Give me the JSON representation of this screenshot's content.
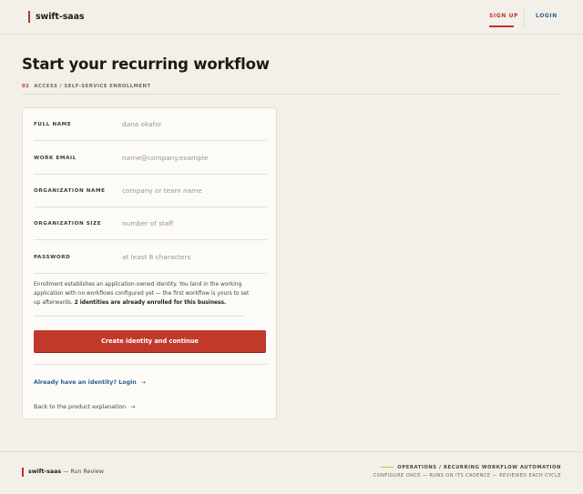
{
  "header": {
    "brand": "swift-saas",
    "nav": {
      "signup": "SIGN UP",
      "login": "LOGIN"
    }
  },
  "page": {
    "title": "Start your recurring workflow",
    "breadcrumb": {
      "step": "02",
      "text": "ACCESS / SELF-SERVICE ENROLLMENT"
    }
  },
  "form": {
    "fields": [
      {
        "label": "FULL NAME",
        "placeholder": "dana okafor"
      },
      {
        "label": "WORK EMAIL",
        "placeholder": "name@company.example"
      },
      {
        "label": "ORGANIZATION NAME",
        "placeholder": "company or team name"
      },
      {
        "label": "ORGANIZATION SIZE",
        "placeholder": "number of staff"
      },
      {
        "label": "PASSWORD",
        "placeholder": "at least 8 characters"
      }
    ],
    "note": "Enrollment establishes an application-owned identity. You land in the working application with no workflows configured yet — the first workflow is yours to set up afterwards.",
    "note_strong": "2 identities are already enrolled for this business.",
    "submit_label": "Create identity and continue",
    "login_link": "Already have an identity? Login",
    "back_link": "Back to the product explanation",
    "arrow": "→"
  },
  "footer": {
    "brand": "swift-saas",
    "brand_suffix": "— Run Review",
    "tagline": "OPERATIONS / RECURRING WORKFLOW AUTOMATION",
    "sub": "CONFIGURE ONCE — RUNS ON ITS CADENCE — REVIEWED EACH CYCLE"
  },
  "colors": {
    "accent": "#c0392b",
    "link": "#2d5d8e",
    "background": "#f3f0e9",
    "card": "#fcfbf7"
  }
}
